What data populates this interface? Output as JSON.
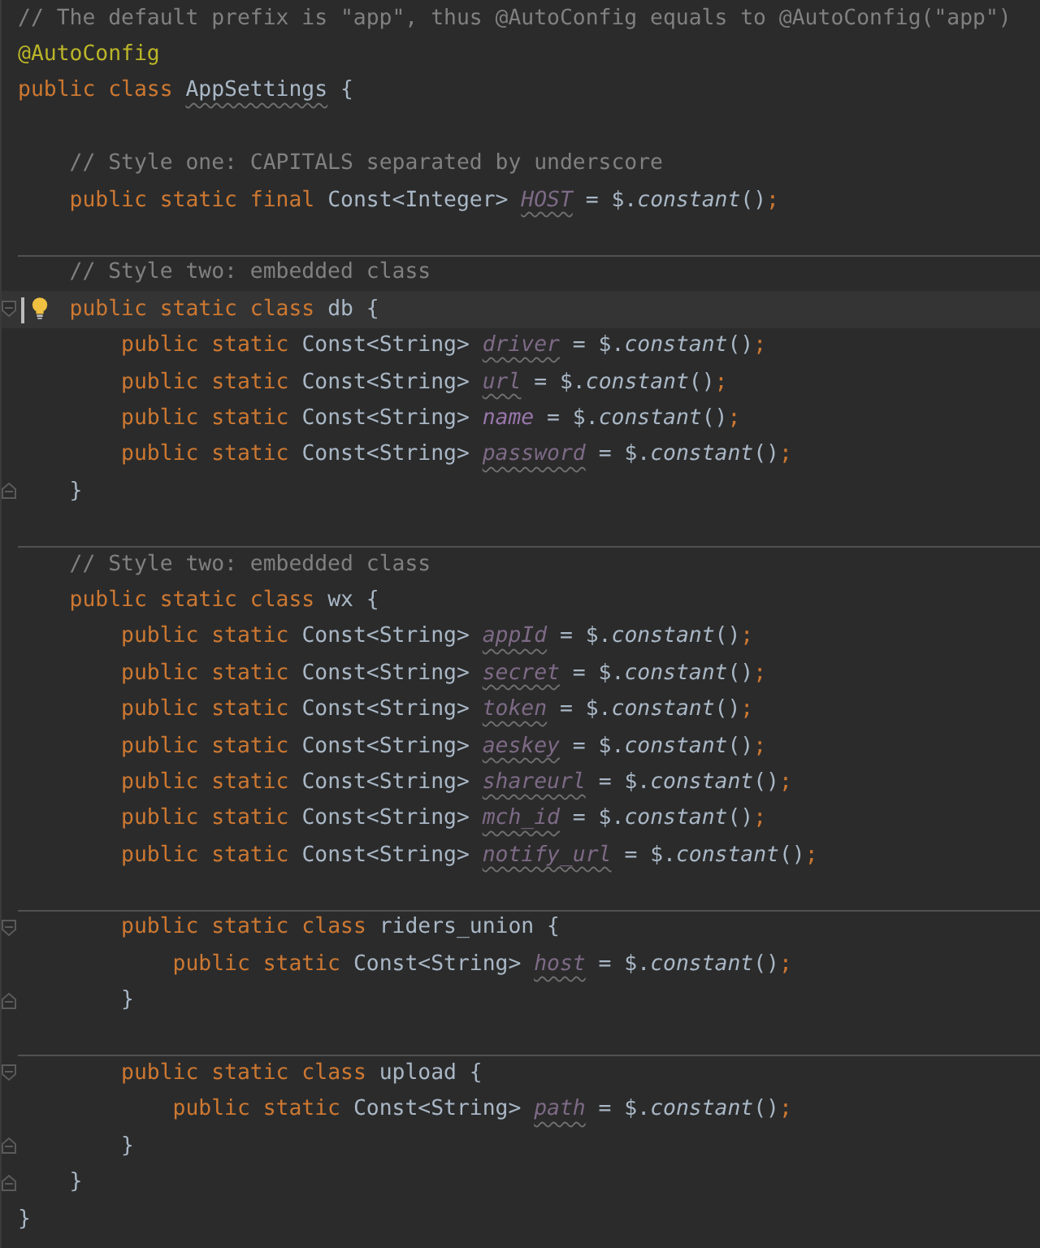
{
  "editor": {
    "lines": [
      {
        "kind": "code",
        "current": false,
        "bulb": false,
        "fold_start": false,
        "fold_end": false,
        "tokens": [
          {
            "text": "// The default prefix is \"app\", thus @AutoConfig equals to @AutoConfig(\"app\")",
            "kind": "comment"
          }
        ]
      },
      {
        "kind": "code",
        "current": false,
        "bulb": false,
        "fold_start": false,
        "fold_end": false,
        "tokens": [
          {
            "text": "@AutoConfig",
            "kind": "annotation"
          }
        ]
      },
      {
        "kind": "code",
        "current": false,
        "bulb": false,
        "fold_start": false,
        "fold_end": false,
        "tokens": [
          {
            "text": "public class ",
            "kind": "keyword"
          },
          {
            "text": "AppSettings",
            "kind": "unused_class"
          },
          {
            "text": " {",
            "kind": "plain"
          }
        ]
      },
      {
        "kind": "blank"
      },
      {
        "kind": "code",
        "current": false,
        "bulb": false,
        "fold_start": false,
        "fold_end": false,
        "tokens": [
          {
            "text": "    // Style one: CAPITALS separated by underscore",
            "kind": "comment"
          }
        ]
      },
      {
        "kind": "code",
        "current": false,
        "bulb": false,
        "fold_start": false,
        "fold_end": false,
        "tokens": [
          {
            "text": "    public static final ",
            "kind": "keyword"
          },
          {
            "text": "Const<Integer> ",
            "kind": "plain"
          },
          {
            "text": "HOST",
            "kind": "unused_field"
          },
          {
            "text": " = $.",
            "kind": "plain"
          },
          {
            "text": "constant",
            "kind": "method"
          },
          {
            "text": "()",
            "kind": "plain"
          },
          {
            "text": ";",
            "kind": "keyword"
          }
        ]
      },
      {
        "kind": "blank"
      },
      {
        "kind": "separator"
      },
      {
        "kind": "code",
        "current": false,
        "bulb": false,
        "fold_start": false,
        "fold_end": false,
        "tokens": [
          {
            "text": "    // Style two: embedded class",
            "kind": "comment"
          }
        ]
      },
      {
        "kind": "code",
        "current": true,
        "bulb": true,
        "fold_start": true,
        "fold_end": false,
        "tokens": [
          {
            "text": "    public static class ",
            "kind": "keyword"
          },
          {
            "text": "db {",
            "kind": "plain"
          }
        ]
      },
      {
        "kind": "code",
        "current": false,
        "bulb": false,
        "fold_start": false,
        "fold_end": false,
        "tokens": [
          {
            "text": "        public static ",
            "kind": "keyword"
          },
          {
            "text": "Const<String> ",
            "kind": "plain"
          },
          {
            "text": "driver",
            "kind": "unused_field"
          },
          {
            "text": " = $.",
            "kind": "plain"
          },
          {
            "text": "constant",
            "kind": "method"
          },
          {
            "text": "()",
            "kind": "plain"
          },
          {
            "text": ";",
            "kind": "keyword"
          }
        ]
      },
      {
        "kind": "code",
        "current": false,
        "bulb": false,
        "fold_start": false,
        "fold_end": false,
        "tokens": [
          {
            "text": "        public static ",
            "kind": "keyword"
          },
          {
            "text": "Const<String> ",
            "kind": "plain"
          },
          {
            "text": "url",
            "kind": "unused_field"
          },
          {
            "text": " = $.",
            "kind": "plain"
          },
          {
            "text": "constant",
            "kind": "method"
          },
          {
            "text": "()",
            "kind": "plain"
          },
          {
            "text": ";",
            "kind": "keyword"
          }
        ]
      },
      {
        "kind": "code",
        "current": false,
        "bulb": false,
        "fold_start": false,
        "fold_end": false,
        "tokens": [
          {
            "text": "        public static ",
            "kind": "keyword"
          },
          {
            "text": "Const<String> ",
            "kind": "plain"
          },
          {
            "text": "name",
            "kind": "field"
          },
          {
            "text": " = $.",
            "kind": "plain"
          },
          {
            "text": "constant",
            "kind": "method"
          },
          {
            "text": "()",
            "kind": "plain"
          },
          {
            "text": ";",
            "kind": "keyword"
          }
        ]
      },
      {
        "kind": "code",
        "current": false,
        "bulb": false,
        "fold_start": false,
        "fold_end": false,
        "tokens": [
          {
            "text": "        public static ",
            "kind": "keyword"
          },
          {
            "text": "Const<String> ",
            "kind": "plain"
          },
          {
            "text": "password",
            "kind": "unused_field"
          },
          {
            "text": " = $.",
            "kind": "plain"
          },
          {
            "text": "constant",
            "kind": "method"
          },
          {
            "text": "()",
            "kind": "plain"
          },
          {
            "text": ";",
            "kind": "keyword"
          }
        ]
      },
      {
        "kind": "code",
        "current": false,
        "bulb": false,
        "fold_start": false,
        "fold_end": true,
        "tokens": [
          {
            "text": "    }",
            "kind": "plain"
          }
        ]
      },
      {
        "kind": "blank"
      },
      {
        "kind": "separator"
      },
      {
        "kind": "code",
        "current": false,
        "bulb": false,
        "fold_start": false,
        "fold_end": false,
        "tokens": [
          {
            "text": "    // Style two: embedded class",
            "kind": "comment"
          }
        ]
      },
      {
        "kind": "code",
        "current": false,
        "bulb": false,
        "fold_start": false,
        "fold_end": false,
        "tokens": [
          {
            "text": "    public static class ",
            "kind": "keyword"
          },
          {
            "text": "wx {",
            "kind": "plain"
          }
        ]
      },
      {
        "kind": "code",
        "current": false,
        "bulb": false,
        "fold_start": false,
        "fold_end": false,
        "tokens": [
          {
            "text": "        public static ",
            "kind": "keyword"
          },
          {
            "text": "Const<String> ",
            "kind": "plain"
          },
          {
            "text": "appId",
            "kind": "unused_field"
          },
          {
            "text": " = $.",
            "kind": "plain"
          },
          {
            "text": "constant",
            "kind": "method"
          },
          {
            "text": "()",
            "kind": "plain"
          },
          {
            "text": ";",
            "kind": "keyword"
          }
        ]
      },
      {
        "kind": "code",
        "current": false,
        "bulb": false,
        "fold_start": false,
        "fold_end": false,
        "tokens": [
          {
            "text": "        public static ",
            "kind": "keyword"
          },
          {
            "text": "Const<String> ",
            "kind": "plain"
          },
          {
            "text": "secret",
            "kind": "unused_field"
          },
          {
            "text": " = $.",
            "kind": "plain"
          },
          {
            "text": "constant",
            "kind": "method"
          },
          {
            "text": "()",
            "kind": "plain"
          },
          {
            "text": ";",
            "kind": "keyword"
          }
        ]
      },
      {
        "kind": "code",
        "current": false,
        "bulb": false,
        "fold_start": false,
        "fold_end": false,
        "tokens": [
          {
            "text": "        public static ",
            "kind": "keyword"
          },
          {
            "text": "Const<String> ",
            "kind": "plain"
          },
          {
            "text": "token",
            "kind": "unused_field"
          },
          {
            "text": " = $.",
            "kind": "plain"
          },
          {
            "text": "constant",
            "kind": "method"
          },
          {
            "text": "()",
            "kind": "plain"
          },
          {
            "text": ";",
            "kind": "keyword"
          }
        ]
      },
      {
        "kind": "code",
        "current": false,
        "bulb": false,
        "fold_start": false,
        "fold_end": false,
        "tokens": [
          {
            "text": "        public static ",
            "kind": "keyword"
          },
          {
            "text": "Const<String> ",
            "kind": "plain"
          },
          {
            "text": "aeskey",
            "kind": "unused_field"
          },
          {
            "text": " = $.",
            "kind": "plain"
          },
          {
            "text": "constant",
            "kind": "method"
          },
          {
            "text": "()",
            "kind": "plain"
          },
          {
            "text": ";",
            "kind": "keyword"
          }
        ]
      },
      {
        "kind": "code",
        "current": false,
        "bulb": false,
        "fold_start": false,
        "fold_end": false,
        "tokens": [
          {
            "text": "        public static ",
            "kind": "keyword"
          },
          {
            "text": "Const<String> ",
            "kind": "plain"
          },
          {
            "text": "shareurl",
            "kind": "unused_field"
          },
          {
            "text": " = $.",
            "kind": "plain"
          },
          {
            "text": "constant",
            "kind": "method"
          },
          {
            "text": "()",
            "kind": "plain"
          },
          {
            "text": ";",
            "kind": "keyword"
          }
        ]
      },
      {
        "kind": "code",
        "current": false,
        "bulb": false,
        "fold_start": false,
        "fold_end": false,
        "tokens": [
          {
            "text": "        public static ",
            "kind": "keyword"
          },
          {
            "text": "Const<String> ",
            "kind": "plain"
          },
          {
            "text": "mch_id",
            "kind": "unused_field"
          },
          {
            "text": " = $.",
            "kind": "plain"
          },
          {
            "text": "constant",
            "kind": "method"
          },
          {
            "text": "()",
            "kind": "plain"
          },
          {
            "text": ";",
            "kind": "keyword"
          }
        ]
      },
      {
        "kind": "code",
        "current": false,
        "bulb": false,
        "fold_start": false,
        "fold_end": false,
        "tokens": [
          {
            "text": "        public static ",
            "kind": "keyword"
          },
          {
            "text": "Const<String> ",
            "kind": "plain"
          },
          {
            "text": "notify_url",
            "kind": "unused_field"
          },
          {
            "text": " = $.",
            "kind": "plain"
          },
          {
            "text": "constant",
            "kind": "method"
          },
          {
            "text": "()",
            "kind": "plain"
          },
          {
            "text": ";",
            "kind": "keyword"
          }
        ]
      },
      {
        "kind": "blank"
      },
      {
        "kind": "separator"
      },
      {
        "kind": "code",
        "current": false,
        "bulb": false,
        "fold_start": true,
        "fold_end": false,
        "tokens": [
          {
            "text": "        public static class ",
            "kind": "keyword"
          },
          {
            "text": "riders_union {",
            "kind": "plain"
          }
        ]
      },
      {
        "kind": "code",
        "current": false,
        "bulb": false,
        "fold_start": false,
        "fold_end": false,
        "tokens": [
          {
            "text": "            public static ",
            "kind": "keyword"
          },
          {
            "text": "Const<String> ",
            "kind": "plain"
          },
          {
            "text": "host",
            "kind": "unused_field"
          },
          {
            "text": " = $.",
            "kind": "plain"
          },
          {
            "text": "constant",
            "kind": "method"
          },
          {
            "text": "()",
            "kind": "plain"
          },
          {
            "text": ";",
            "kind": "keyword"
          }
        ]
      },
      {
        "kind": "code",
        "current": false,
        "bulb": false,
        "fold_start": false,
        "fold_end": true,
        "tokens": [
          {
            "text": "        }",
            "kind": "plain"
          }
        ]
      },
      {
        "kind": "blank"
      },
      {
        "kind": "separator"
      },
      {
        "kind": "code",
        "current": false,
        "bulb": false,
        "fold_start": true,
        "fold_end": false,
        "tokens": [
          {
            "text": "        public static class ",
            "kind": "keyword"
          },
          {
            "text": "upload {",
            "kind": "plain"
          }
        ]
      },
      {
        "kind": "code",
        "current": false,
        "bulb": false,
        "fold_start": false,
        "fold_end": false,
        "tokens": [
          {
            "text": "            public static ",
            "kind": "keyword"
          },
          {
            "text": "Const<String> ",
            "kind": "plain"
          },
          {
            "text": "path",
            "kind": "unused_field"
          },
          {
            "text": " = $.",
            "kind": "plain"
          },
          {
            "text": "constant",
            "kind": "method"
          },
          {
            "text": "()",
            "kind": "plain"
          },
          {
            "text": ";",
            "kind": "keyword"
          }
        ]
      },
      {
        "kind": "code",
        "current": false,
        "bulb": false,
        "fold_start": false,
        "fold_end": true,
        "tokens": [
          {
            "text": "        }",
            "kind": "plain"
          }
        ]
      },
      {
        "kind": "code",
        "current": false,
        "bulb": false,
        "fold_start": false,
        "fold_end": true,
        "tokens": [
          {
            "text": "    }",
            "kind": "plain"
          }
        ]
      },
      {
        "kind": "code",
        "current": false,
        "bulb": false,
        "fold_start": false,
        "fold_end": false,
        "tokens": [
          {
            "text": "}",
            "kind": "plain"
          }
        ]
      }
    ]
  }
}
